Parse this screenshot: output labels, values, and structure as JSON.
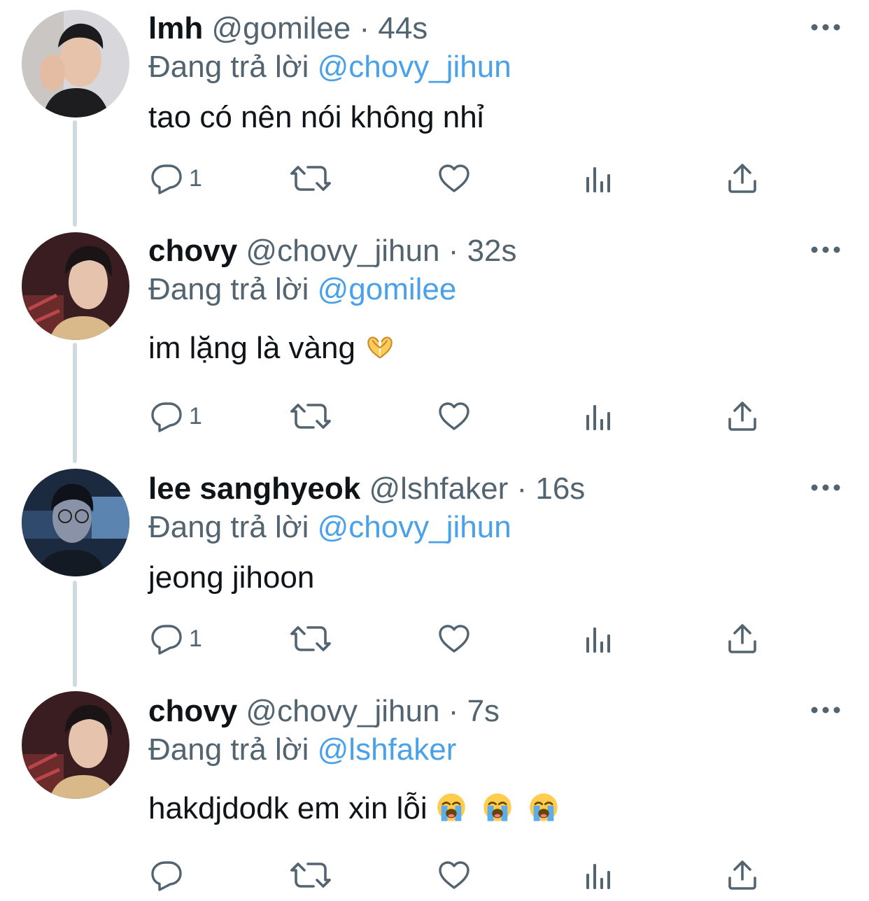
{
  "tweets": [
    {
      "name": "lmh",
      "handle": "@gomilee",
      "dot": "·",
      "time": "44s",
      "reply_prefix": "Đang trả lời",
      "reply_to": "@chovy_jihun",
      "text": "tao có nên nói không nhỉ",
      "reply_count": "1",
      "avatar": "avatar-lmh"
    },
    {
      "name": "chovy",
      "handle": "@chovy_jihun",
      "dot": "·",
      "time": "32s",
      "reply_prefix": "Đang trả lời",
      "reply_to": "@gomilee",
      "text": "im lặng là vàng",
      "emoji": "heart-hands-emoji",
      "reply_count": "1",
      "avatar": "avatar-chovy"
    },
    {
      "name": "lee sanghyeok",
      "handle": "@lshfaker",
      "dot": "·",
      "time": "16s",
      "reply_prefix": "Đang trả lời",
      "reply_to": "@chovy_jihun",
      "text": "jeong jihoon",
      "reply_count": "1",
      "avatar": "avatar-faker"
    },
    {
      "name": "chovy",
      "handle": "@chovy_jihun",
      "dot": "·",
      "time": "7s",
      "reply_prefix": "Đang trả lời",
      "reply_to": "@lshfaker",
      "text": "hakdjdodk em xin lỗi",
      "emoji": "loudly-crying-face-emoji ×3",
      "reply_count": "",
      "avatar": "avatar-chovy"
    }
  ],
  "icons": {
    "reply": "reply-icon",
    "retweet": "retweet-icon",
    "like": "heart-icon",
    "views": "views-icon",
    "share": "share-icon",
    "more": "more-icon"
  },
  "colors": {
    "text": "#0f1419",
    "secondary": "#536471",
    "link": "#4aa1e8",
    "thread_line": "#cfd9de"
  }
}
